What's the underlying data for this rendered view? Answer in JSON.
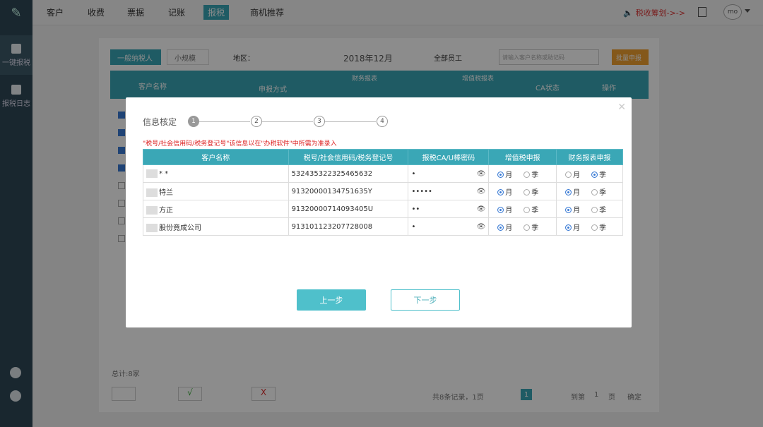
{
  "nav": {
    "items": [
      {
        "label": "客户"
      },
      {
        "label": "收费"
      },
      {
        "label": "票据"
      },
      {
        "label": "记账"
      },
      {
        "label": "报税"
      },
      {
        "label": "商机推荐"
      }
    ],
    "tax_plan_label": "税收筹划->->",
    "avatar_text": "mo"
  },
  "sidebar": {
    "items": [
      {
        "label": "一键报税"
      },
      {
        "label": "报税日志"
      }
    ]
  },
  "background": {
    "tab_general": "一般纳税人",
    "tab_small": "小规模",
    "region_label": "地区：",
    "year_label": "2018年12月",
    "staff_select": "全部员工",
    "search_placeholder": "请输入客户名称或助记码",
    "batch_button": "批量申报",
    "col_customer": "客户名称",
    "col_method": "申报方式",
    "col_finance": "财务报表",
    "col_vat": "增值税报表",
    "col_ca": "CA状态",
    "col_action": "操作",
    "total_label": "总计:8家",
    "pager_text": "共8条记录，1页",
    "current_page": "1",
    "goto_label": "到第",
    "goto_page": "1",
    "page_unit": "页",
    "confirm_label": "确定"
  },
  "modal": {
    "title": "信息核定",
    "steps": [
      "1",
      "2",
      "3",
      "4"
    ],
    "notice": "\"税号/社会信用码/税务登记号\"该信息以在\"办税软件\"中所需为准录入",
    "headers": {
      "customer": "客户名称",
      "tax_id": "税号/社会信用码/税务登记号",
      "ca_password": "报税CA/U棒密码",
      "vat": "增值税申报",
      "finance": "财务报表申报"
    },
    "rows": [
      {
        "name": "* *",
        "tax_id": "532435322325465632",
        "password": "•",
        "vat_month": true,
        "finance_month": false
      },
      {
        "name": "特兰",
        "tax_id": "91320000134751635Y",
        "password": "•••••",
        "vat_month": true,
        "finance_month": true
      },
      {
        "name": "方正",
        "tax_id": "91320000714093405U",
        "password": "••",
        "vat_month": true,
        "finance_month": true
      },
      {
        "name": "股份竟成公司",
        "tax_id": "913101123207728008",
        "password": "•",
        "vat_month": true,
        "finance_month": true
      }
    ],
    "month_label": "月",
    "season_label": "季",
    "prev_button": "上一步",
    "next_button": "下一步"
  },
  "colors": {
    "accent": "#3aa7b6",
    "sidebar": "#2f4756",
    "notice": "#dd2222",
    "batch": "#f0a030"
  }
}
